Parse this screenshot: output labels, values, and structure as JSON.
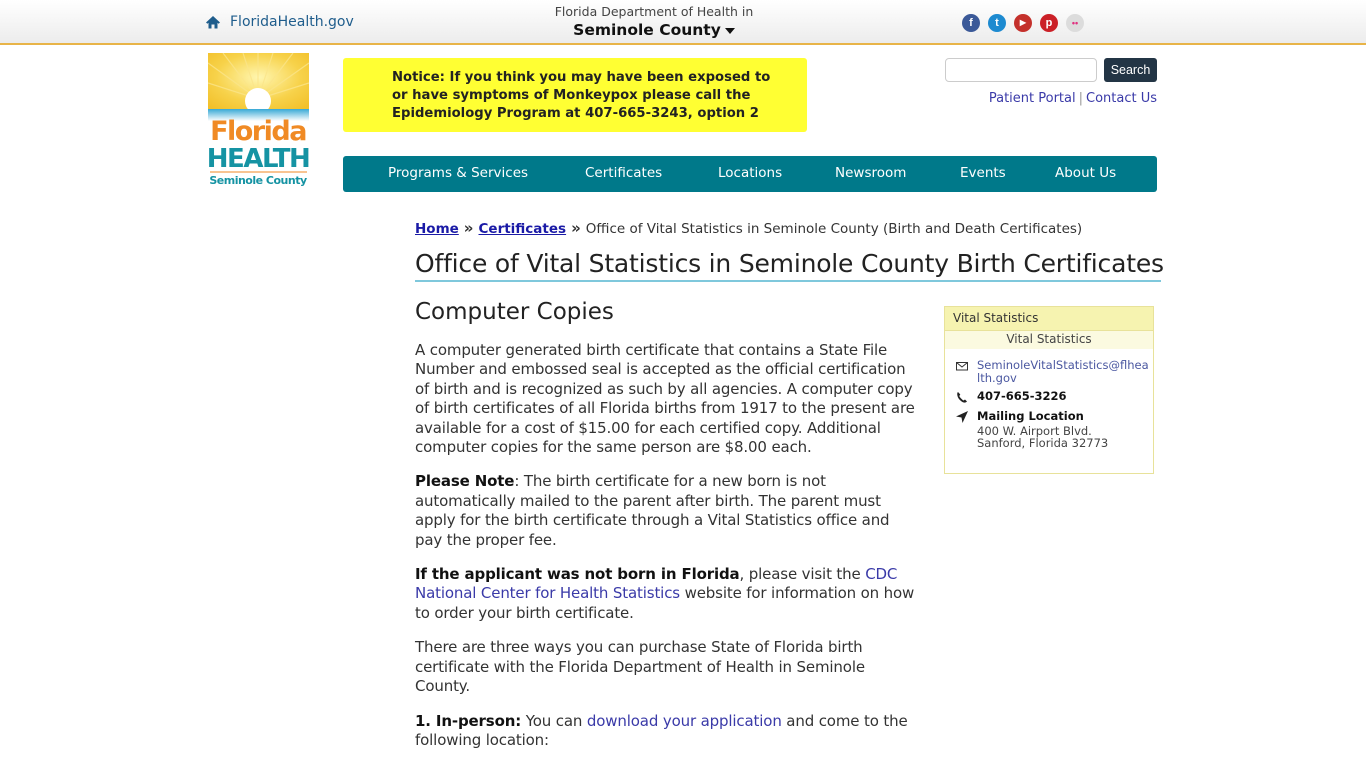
{
  "topbar": {
    "home_link": "FloridaHealth.gov",
    "dept_sub": "Florida Department of Health in",
    "county": "Seminole County",
    "social": [
      {
        "name": "facebook",
        "glyph": "f",
        "color": "#3b5998"
      },
      {
        "name": "twitter",
        "glyph": "t",
        "color": "#1d8ad0"
      },
      {
        "name": "youtube",
        "glyph": "▶",
        "color": "#c4302b"
      },
      {
        "name": "pinterest",
        "glyph": "p",
        "color": "#cb2027"
      },
      {
        "name": "flickr",
        "glyph": "••",
        "color": "#d9d9d9"
      }
    ]
  },
  "logo": {
    "line1": "Florida",
    "line2": "HEALTH",
    "line3": "Seminole County"
  },
  "notice": "Notice: If you think you may have been exposed to or have symptoms of Monkeypox please call the Epidemiology Program at 407-665-3243, option 2",
  "search": {
    "placeholder": "",
    "value": "",
    "button": "Search"
  },
  "util_links": {
    "patient_portal": "Patient Portal",
    "separator": "|",
    "contact": "Contact Us"
  },
  "nav": [
    "Programs & Services",
    "Certificates",
    "Locations",
    "Newsroom",
    "Events",
    "About Us"
  ],
  "breadcrumb": {
    "home": "Home",
    "certificates": "Certificates",
    "sep": "»",
    "current": "Office of Vital Statistics in Seminole County (Birth and Death Certificates)"
  },
  "page_title": "Office of Vital Statistics in Seminole County Birth Certificates",
  "main": {
    "heading": "Computer Copies",
    "p1": "A computer generated birth certificate that contains a State File Number and embossed seal is accepted as the official certification of birth and is recognized as such by all agencies. A computer copy of birth certificates of all Florida births from 1917 to the present are available for a cost of $15.00 for each certified copy. Additional computer copies for the same person are $8.00 each.",
    "p2_bold": "Please Note",
    "p2_text": ": The birth certificate for a new born is not automatically mailed to the parent after birth. The parent must apply for the birth certificate through a Vital Statistics office and pay the proper fee.",
    "p3_bold": "If the applicant was not born in Florida",
    "p3_pre": ", please visit the ",
    "p3_link": "CDC National Center for Health Statistics",
    "p3_post": " website for information on how to order your birth certificate.",
    "p4": "There are three ways you can purchase State of Florida birth certificate with the Florida Department of Health in Seminole County.",
    "p5_bold": "1. In-person:",
    "p5_pre": " You can ",
    "p5_link": "download your application",
    "p5_post": " and come to the following location:"
  },
  "card": {
    "header": "Vital Statistics",
    "subheader": "Vital Statistics",
    "email": "SeminoleVitalStatistics@flhealth.gov",
    "phone": "407-665-3226",
    "mailing_label": "Mailing Location",
    "address1": "400 W. Airport Blvd.",
    "address2": "Sanford, Florida 32773"
  }
}
